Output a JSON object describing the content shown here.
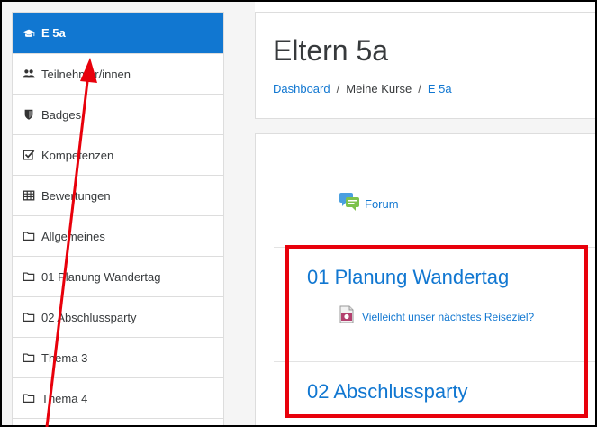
{
  "sidebar": {
    "items": [
      {
        "label": "E 5a",
        "icon": "graduation-cap-icon"
      },
      {
        "label": "Teilnehmer/innen",
        "icon": "users-icon"
      },
      {
        "label": "Badges",
        "icon": "shield-icon"
      },
      {
        "label": "Kompetenzen",
        "icon": "checkbox-icon"
      },
      {
        "label": "Bewertungen",
        "icon": "table-icon"
      },
      {
        "label": "Allgemeines",
        "icon": "folder-icon"
      },
      {
        "label": "01 Planung Wandertag",
        "icon": "folder-icon"
      },
      {
        "label": "02 Abschlussparty",
        "icon": "folder-icon"
      },
      {
        "label": "Thema 3",
        "icon": "folder-icon"
      },
      {
        "label": "Thema 4",
        "icon": "folder-icon"
      }
    ]
  },
  "header": {
    "title": "Eltern 5a",
    "breadcrumb": [
      "Dashboard",
      "Meine Kurse",
      "E 5a"
    ]
  },
  "content": {
    "forum_label": "Forum",
    "sections": [
      {
        "title": "01 Planung Wandertag",
        "activity": "Vielleicht unser nächstes Reiseziel?"
      },
      {
        "title": "02 Abschlussparty"
      }
    ]
  },
  "colors": {
    "accent": "#1177d1",
    "annotation": "#e8000b"
  }
}
